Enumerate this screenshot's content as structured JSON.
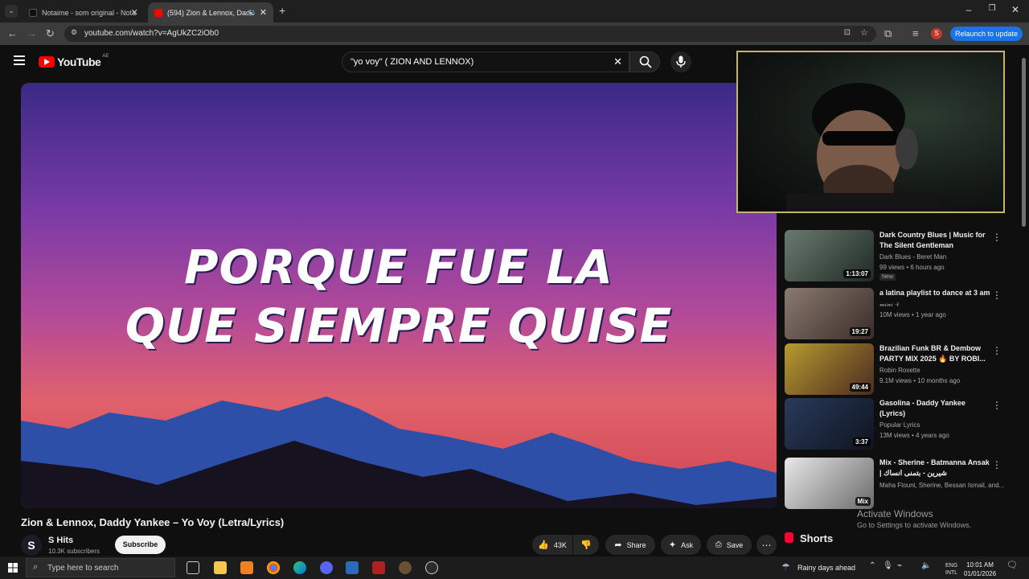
{
  "browser": {
    "tabs": [
      {
        "title": "Notaime - som original - Nota"
      },
      {
        "title": "(594) Zion & Lennox, Dadd"
      }
    ],
    "url": "youtube.com/watch?v=AgUkZC2iOb0",
    "relaunch_label": "Relaunch to update",
    "profile_initial": "S"
  },
  "youtube": {
    "logo_text": "YouTube",
    "region": "AE",
    "search_value": "\"yo voy\" ( ZION AND LENNOX)"
  },
  "video": {
    "lyric_line1": "PORQUE FUE LA",
    "lyric_line2": "QUE SIEMPRE QUISE",
    "title": "Zion & Lennox, Daddy Yankee –  Yo Voy (Letra/Lyrics)",
    "channel_initial": "S",
    "channel_name": "S Hits",
    "channel_subs": "10.3K subscribers",
    "subscribe_label": "Subscribe",
    "like_count": "43K",
    "share_label": "Share",
    "ask_label": "Ask",
    "save_label": "Save"
  },
  "sidebar": {
    "items": [
      {
        "title": "Dark Country Blues | Music for The Silent Gentleman",
        "channel": "Dark Blues - Beret Man",
        "meta": "99 views • 6 hours ago",
        "duration": "1:13:07",
        "badge": "New",
        "thumb_color": "#3a4a40"
      },
      {
        "title": "a latina playlist to dance at 3 am",
        "channel": "𝓂𝒾𝓃𝒾 ·ғ",
        "meta": "10M views • 1 year ago",
        "duration": "19:27",
        "thumb_color": "#5a4a44"
      },
      {
        "title": "Brazilian Funk BR & Dembow PARTY MIX 2025 🔥 BY ROBI...",
        "channel": "Robin Roxette",
        "meta": "9.1M views • 10 months ago",
        "duration": "49:44",
        "thumb_color": "#6a5a20"
      },
      {
        "title": "Gasolina - Daddy Yankee (Lyrics)",
        "channel": "Popular Lyrics",
        "meta": "13M views • 4 years ago",
        "duration": "3:37",
        "thumb_color": "#1c2a40"
      },
      {
        "title": "Mix - Sherine - Batmanna Ansak | شيرين - بتمنى انساك",
        "channel": "Maha Ftouni, Sherine, Bessan Ismail, and...",
        "meta": "",
        "duration": "Mix",
        "thumb_color": "#cfcfcf"
      }
    ],
    "shorts_label": "Shorts"
  },
  "watermark": {
    "line1": "Activate Windows",
    "line2": "Go to Settings to activate Windows."
  },
  "taskbar": {
    "search_placeholder": "Type here to search",
    "weather": "Rainy days ahead",
    "lang1": "ENG",
    "lang2": "INTL",
    "time": "10:01 AM",
    "date": "01/01/2026"
  }
}
